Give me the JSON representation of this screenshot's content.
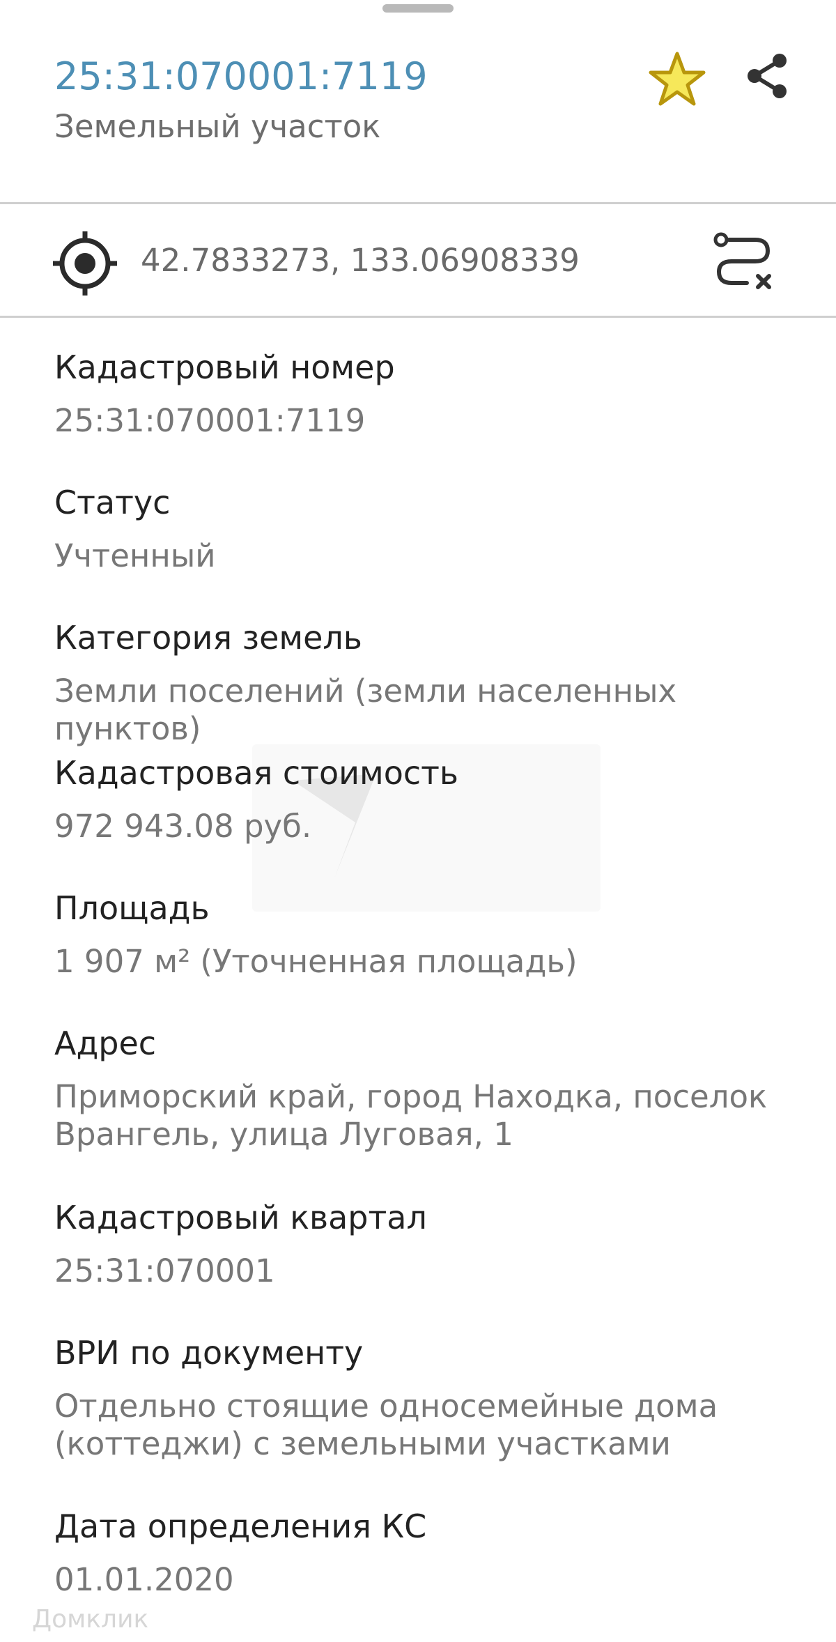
{
  "header": {
    "title": "25:31:070001:7119",
    "subtitle": "Земельный участок",
    "favorite_icon": "star-icon",
    "share_icon": "share-icon",
    "colors": {
      "title": "#4d8fb5",
      "star_fill": "#f6e85a",
      "star_stroke": "#b8960c"
    }
  },
  "location": {
    "icon": "crosshair-icon",
    "coordinates": "42.7833273, 133.06908339",
    "route_icon": "route-clear-icon"
  },
  "fields": [
    {
      "label": "Кадастровый номер",
      "value": "25:31:070001:7119"
    },
    {
      "label": "Статус",
      "value": "Учтенный"
    },
    {
      "label": "Категория земель",
      "value": "Земли поселений (земли населенных пунктов)"
    },
    {
      "label": "Кадастровая стоимость",
      "value": "972 943.08 руб."
    },
    {
      "label": "Площадь",
      "value": "1 907 м² (Уточненная площадь)"
    },
    {
      "label": "Адрес",
      "value": "Приморский край, город Находка, поселок Врангель, улица Луговая, 1"
    },
    {
      "label": "Кадастровый квартал",
      "value": "25:31:070001"
    },
    {
      "label": "ВРИ по документу",
      "value": "Отдельно стоящие односемейные дома (коттеджи) с земельными участками"
    },
    {
      "label": "Дата определения КС",
      "value": "01.01.2020"
    }
  ],
  "watermark": {
    "brand": "Домклик"
  }
}
